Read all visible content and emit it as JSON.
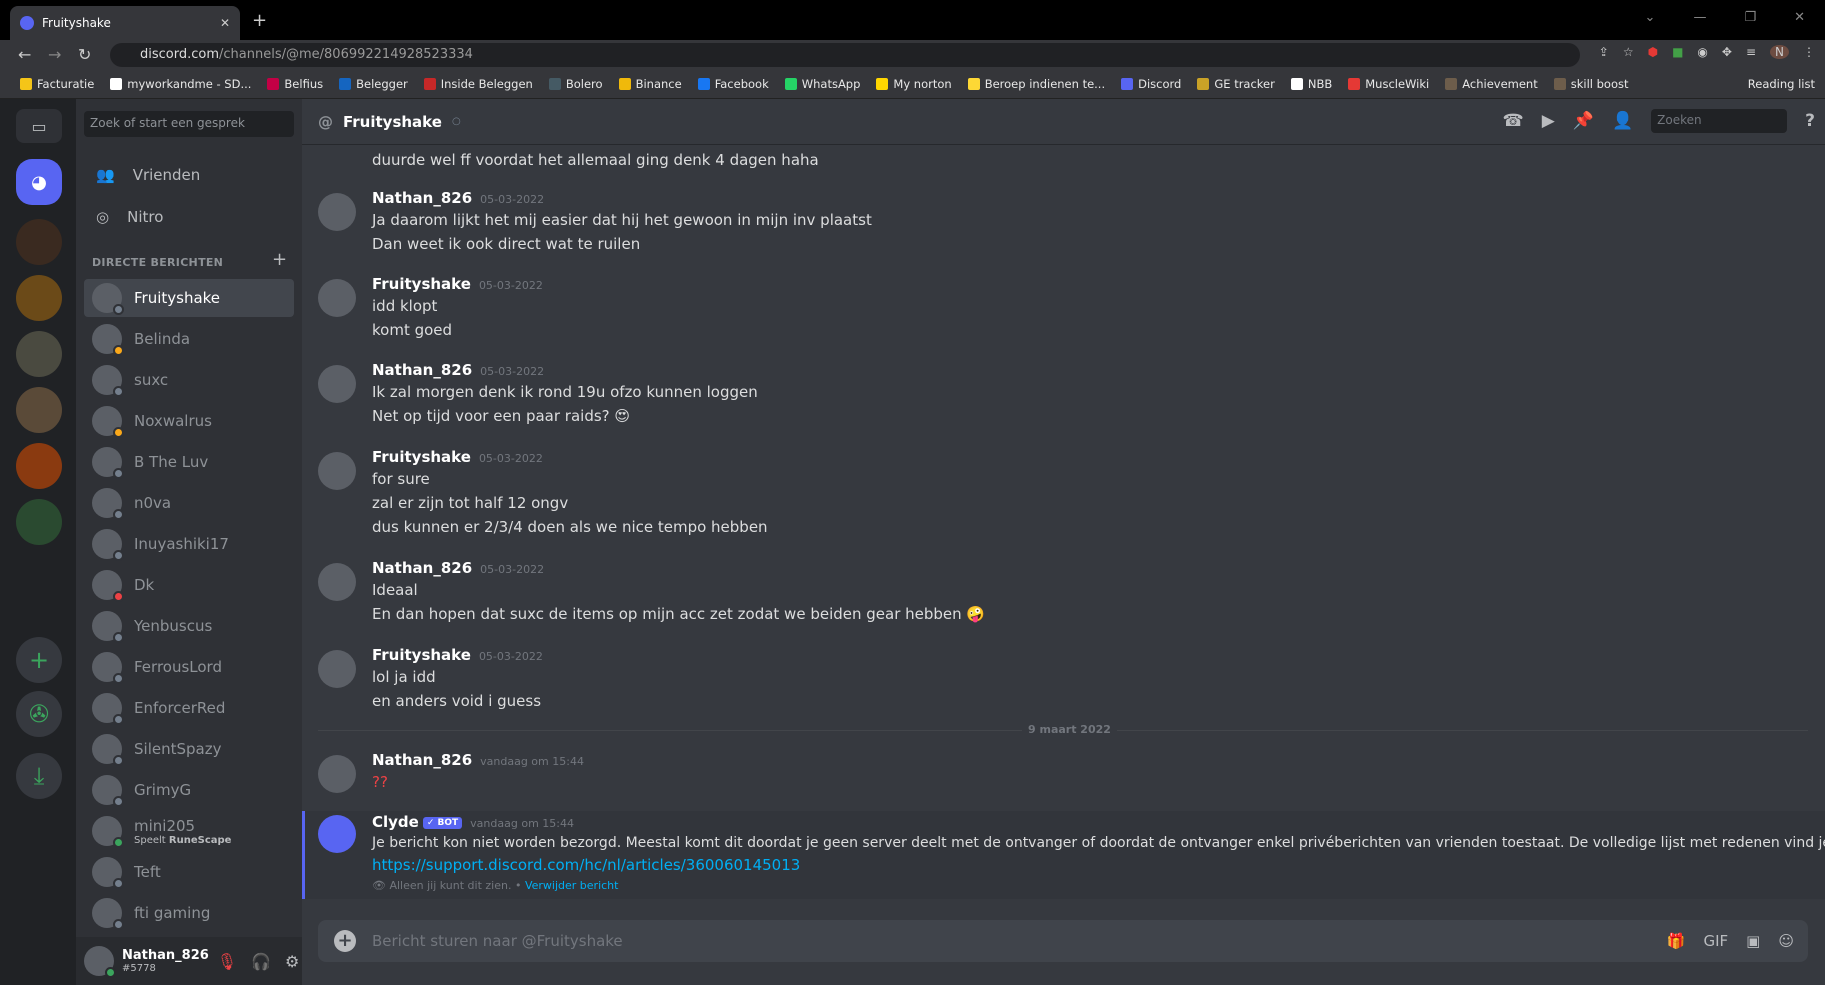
{
  "browser": {
    "tab_title": "Fruityshake",
    "url_host": "discord.com",
    "url_path": "/channels/@me/806992214928523334",
    "bookmarks": [
      {
        "label": "Facturatie",
        "color": "#f5c518"
      },
      {
        "label": "myworkandme - SD...",
        "color": "#ffffff"
      },
      {
        "label": "Belfius",
        "color": "#c30045"
      },
      {
        "label": "Belegger",
        "color": "#1565c0"
      },
      {
        "label": "Inside Beleggen",
        "color": "#c62828"
      },
      {
        "label": "Bolero",
        "color": "#455a64"
      },
      {
        "label": "Binance",
        "color": "#f0b90b"
      },
      {
        "label": "Facebook",
        "color": "#1877f2"
      },
      {
        "label": "WhatsApp",
        "color": "#25d366"
      },
      {
        "label": "My norton",
        "color": "#ffd600"
      },
      {
        "label": "Beroep indienen te...",
        "color": "#fdd835"
      },
      {
        "label": "Discord",
        "color": "#5865f2"
      },
      {
        "label": "GE tracker",
        "color": "#c9a227"
      },
      {
        "label": "NBB",
        "color": "#ffffff"
      },
      {
        "label": "MuscleWiki",
        "color": "#e53935"
      },
      {
        "label": "Achievement",
        "color": "#6d5d4b"
      },
      {
        "label": "skill boost",
        "color": "#6d5d4b"
      }
    ],
    "reading_list": "Reading list",
    "profile_initial": "N"
  },
  "sidebar": {
    "search_placeholder": "Zoek of start een gesprek",
    "nav": [
      {
        "label": "Vrienden"
      },
      {
        "label": "Nitro"
      }
    ],
    "dm_header": "DIRECTE BERICHTEN",
    "dms": [
      {
        "name": "Fruityshake",
        "status": "#747f8d"
      },
      {
        "name": "Belinda",
        "status": "#faa81a"
      },
      {
        "name": "suxc",
        "status": "#747f8d"
      },
      {
        "name": "Noxwalrus",
        "status": "#faa81a"
      },
      {
        "name": "B The Luv",
        "status": "#747f8d"
      },
      {
        "name": "n0va",
        "status": "#747f8d"
      },
      {
        "name": "Inuyashiki17",
        "status": "#747f8d"
      },
      {
        "name": "Dk",
        "status": "#ed4245"
      },
      {
        "name": "Yenbuscus",
        "status": "#747f8d"
      },
      {
        "name": "FerrousLord",
        "status": "#747f8d"
      },
      {
        "name": "EnforcerRed",
        "status": "#747f8d"
      },
      {
        "name": "SilentSpazy",
        "status": "#747f8d"
      },
      {
        "name": "GrimyG",
        "status": "#747f8d"
      },
      {
        "name": "mini205",
        "status": "#3ba55d",
        "activity_prefix": "Speelt ",
        "activity": "RuneScape"
      },
      {
        "name": "Teft",
        "status": "#747f8d"
      },
      {
        "name": "fti gaming",
        "status": "#747f8d"
      }
    ],
    "user": {
      "name": "Nathan_826",
      "tag": "#5778"
    }
  },
  "chat": {
    "channel": "Fruityshake",
    "search_placeholder": "Zoeken",
    "top_partial": "duurde wel ff voordat het allemaal ging denk 4 dagen haha",
    "messages": [
      {
        "author": "Nathan_826",
        "time": "05-03-2022",
        "lines": [
          "Ja daarom lijkt het mij easier dat hij het gewoon in mijn inv plaatst",
          "Dan weet ik ook direct wat te ruilen"
        ]
      },
      {
        "author": "Fruityshake",
        "time": "05-03-2022",
        "lines": [
          "idd klopt",
          "komt goed"
        ]
      },
      {
        "author": "Nathan_826",
        "time": "05-03-2022",
        "lines": [
          "Ik zal morgen denk ik rond 19u ofzo kunnen loggen",
          "Net op tijd voor een paar raids? 😍"
        ]
      },
      {
        "author": "Fruityshake",
        "time": "05-03-2022",
        "lines": [
          "for sure",
          "zal er zijn tot half 12 ongv",
          "dus kunnen er 2/3/4 doen als we nice tempo hebben"
        ]
      },
      {
        "author": "Nathan_826",
        "time": "05-03-2022",
        "lines": [
          "Ideaal",
          "En dan hopen dat suxc de items op mijn acc zet zodat we beiden gear hebben 🤪"
        ]
      },
      {
        "author": "Fruityshake",
        "time": "05-03-2022",
        "lines": [
          "lol ja idd",
          "en anders void i guess"
        ]
      }
    ],
    "date_divider": "9 maart 2022",
    "last": {
      "author": "Nathan_826",
      "time": "vandaag om 15:44",
      "text": "??"
    },
    "clyde": {
      "author": "Clyde",
      "badge": "✓ BOT",
      "time": "vandaag om 15:44",
      "text": "Je bericht kon niet worden bezorgd. Meestal komt dit doordat je geen server deelt met de ontvanger of doordat de ontvanger enkel privéberichten van vrienden toestaat. De volledige lijst met redenen vind je hier:",
      "link": "https://support.discord.com/hc/nl/articles/360060145013",
      "note": "Alleen jij kunt dit zien.",
      "sep": " • ",
      "delete": "Verwijder bericht"
    },
    "input_placeholder": "Bericht sturen naar @Fruityshake"
  }
}
